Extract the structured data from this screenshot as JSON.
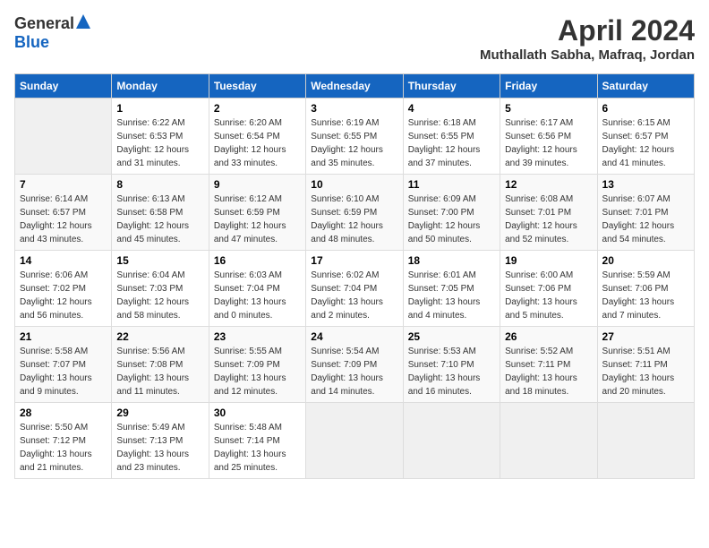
{
  "header": {
    "logo_general": "General",
    "logo_blue": "Blue",
    "month_title": "April 2024",
    "location": "Muthallath Sabha, Mafraq, Jordan"
  },
  "days_of_week": [
    "Sunday",
    "Monday",
    "Tuesday",
    "Wednesday",
    "Thursday",
    "Friday",
    "Saturday"
  ],
  "weeks": [
    [
      {
        "day": "",
        "sunrise": "",
        "sunset": "",
        "daylight": ""
      },
      {
        "day": "1",
        "sunrise": "Sunrise: 6:22 AM",
        "sunset": "Sunset: 6:53 PM",
        "daylight": "Daylight: 12 hours and 31 minutes."
      },
      {
        "day": "2",
        "sunrise": "Sunrise: 6:20 AM",
        "sunset": "Sunset: 6:54 PM",
        "daylight": "Daylight: 12 hours and 33 minutes."
      },
      {
        "day": "3",
        "sunrise": "Sunrise: 6:19 AM",
        "sunset": "Sunset: 6:55 PM",
        "daylight": "Daylight: 12 hours and 35 minutes."
      },
      {
        "day": "4",
        "sunrise": "Sunrise: 6:18 AM",
        "sunset": "Sunset: 6:55 PM",
        "daylight": "Daylight: 12 hours and 37 minutes."
      },
      {
        "day": "5",
        "sunrise": "Sunrise: 6:17 AM",
        "sunset": "Sunset: 6:56 PM",
        "daylight": "Daylight: 12 hours and 39 minutes."
      },
      {
        "day": "6",
        "sunrise": "Sunrise: 6:15 AM",
        "sunset": "Sunset: 6:57 PM",
        "daylight": "Daylight: 12 hours and 41 minutes."
      }
    ],
    [
      {
        "day": "7",
        "sunrise": "Sunrise: 6:14 AM",
        "sunset": "Sunset: 6:57 PM",
        "daylight": "Daylight: 12 hours and 43 minutes."
      },
      {
        "day": "8",
        "sunrise": "Sunrise: 6:13 AM",
        "sunset": "Sunset: 6:58 PM",
        "daylight": "Daylight: 12 hours and 45 minutes."
      },
      {
        "day": "9",
        "sunrise": "Sunrise: 6:12 AM",
        "sunset": "Sunset: 6:59 PM",
        "daylight": "Daylight: 12 hours and 47 minutes."
      },
      {
        "day": "10",
        "sunrise": "Sunrise: 6:10 AM",
        "sunset": "Sunset: 6:59 PM",
        "daylight": "Daylight: 12 hours and 48 minutes."
      },
      {
        "day": "11",
        "sunrise": "Sunrise: 6:09 AM",
        "sunset": "Sunset: 7:00 PM",
        "daylight": "Daylight: 12 hours and 50 minutes."
      },
      {
        "day": "12",
        "sunrise": "Sunrise: 6:08 AM",
        "sunset": "Sunset: 7:01 PM",
        "daylight": "Daylight: 12 hours and 52 minutes."
      },
      {
        "day": "13",
        "sunrise": "Sunrise: 6:07 AM",
        "sunset": "Sunset: 7:01 PM",
        "daylight": "Daylight: 12 hours and 54 minutes."
      }
    ],
    [
      {
        "day": "14",
        "sunrise": "Sunrise: 6:06 AM",
        "sunset": "Sunset: 7:02 PM",
        "daylight": "Daylight: 12 hours and 56 minutes."
      },
      {
        "day": "15",
        "sunrise": "Sunrise: 6:04 AM",
        "sunset": "Sunset: 7:03 PM",
        "daylight": "Daylight: 12 hours and 58 minutes."
      },
      {
        "day": "16",
        "sunrise": "Sunrise: 6:03 AM",
        "sunset": "Sunset: 7:04 PM",
        "daylight": "Daylight: 13 hours and 0 minutes."
      },
      {
        "day": "17",
        "sunrise": "Sunrise: 6:02 AM",
        "sunset": "Sunset: 7:04 PM",
        "daylight": "Daylight: 13 hours and 2 minutes."
      },
      {
        "day": "18",
        "sunrise": "Sunrise: 6:01 AM",
        "sunset": "Sunset: 7:05 PM",
        "daylight": "Daylight: 13 hours and 4 minutes."
      },
      {
        "day": "19",
        "sunrise": "Sunrise: 6:00 AM",
        "sunset": "Sunset: 7:06 PM",
        "daylight": "Daylight: 13 hours and 5 minutes."
      },
      {
        "day": "20",
        "sunrise": "Sunrise: 5:59 AM",
        "sunset": "Sunset: 7:06 PM",
        "daylight": "Daylight: 13 hours and 7 minutes."
      }
    ],
    [
      {
        "day": "21",
        "sunrise": "Sunrise: 5:58 AM",
        "sunset": "Sunset: 7:07 PM",
        "daylight": "Daylight: 13 hours and 9 minutes."
      },
      {
        "day": "22",
        "sunrise": "Sunrise: 5:56 AM",
        "sunset": "Sunset: 7:08 PM",
        "daylight": "Daylight: 13 hours and 11 minutes."
      },
      {
        "day": "23",
        "sunrise": "Sunrise: 5:55 AM",
        "sunset": "Sunset: 7:09 PM",
        "daylight": "Daylight: 13 hours and 12 minutes."
      },
      {
        "day": "24",
        "sunrise": "Sunrise: 5:54 AM",
        "sunset": "Sunset: 7:09 PM",
        "daylight": "Daylight: 13 hours and 14 minutes."
      },
      {
        "day": "25",
        "sunrise": "Sunrise: 5:53 AM",
        "sunset": "Sunset: 7:10 PM",
        "daylight": "Daylight: 13 hours and 16 minutes."
      },
      {
        "day": "26",
        "sunrise": "Sunrise: 5:52 AM",
        "sunset": "Sunset: 7:11 PM",
        "daylight": "Daylight: 13 hours and 18 minutes."
      },
      {
        "day": "27",
        "sunrise": "Sunrise: 5:51 AM",
        "sunset": "Sunset: 7:11 PM",
        "daylight": "Daylight: 13 hours and 20 minutes."
      }
    ],
    [
      {
        "day": "28",
        "sunrise": "Sunrise: 5:50 AM",
        "sunset": "Sunset: 7:12 PM",
        "daylight": "Daylight: 13 hours and 21 minutes."
      },
      {
        "day": "29",
        "sunrise": "Sunrise: 5:49 AM",
        "sunset": "Sunset: 7:13 PM",
        "daylight": "Daylight: 13 hours and 23 minutes."
      },
      {
        "day": "30",
        "sunrise": "Sunrise: 5:48 AM",
        "sunset": "Sunset: 7:14 PM",
        "daylight": "Daylight: 13 hours and 25 minutes."
      },
      {
        "day": "",
        "sunrise": "",
        "sunset": "",
        "daylight": ""
      },
      {
        "day": "",
        "sunrise": "",
        "sunset": "",
        "daylight": ""
      },
      {
        "day": "",
        "sunrise": "",
        "sunset": "",
        "daylight": ""
      },
      {
        "day": "",
        "sunrise": "",
        "sunset": "",
        "daylight": ""
      }
    ]
  ]
}
